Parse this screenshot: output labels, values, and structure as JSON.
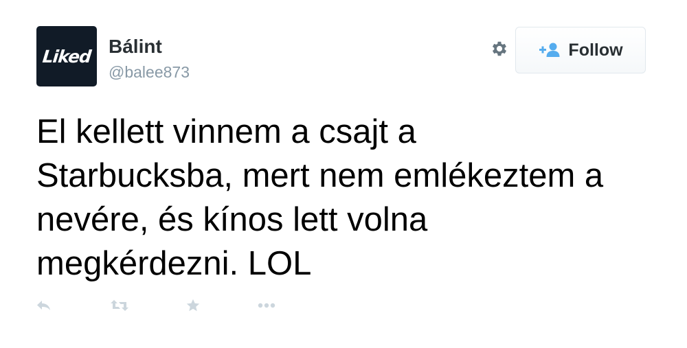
{
  "user": {
    "name": "Bálint",
    "handle": "@balee873",
    "avatar_text": "Liked"
  },
  "follow_button": {
    "label": "Follow",
    "icon": "add-user-icon",
    "accent_color": "#55acee"
  },
  "settings_icon": "gear-icon",
  "tweet": {
    "lines": [
      "El kellett vinnem a csajt a",
      "Starbucksba, mert nem emlékeztem a",
      "nevére, és kínos lett volna",
      "megkérdezni. LOL"
    ]
  },
  "actions": [
    "reply-icon",
    "retweet-icon",
    "favorite-icon",
    "more-icon"
  ],
  "colors": {
    "name": "#292f33",
    "handle": "#8899a6",
    "action_icons": "#ccd6dd",
    "avatar_bg": "#111b27"
  }
}
